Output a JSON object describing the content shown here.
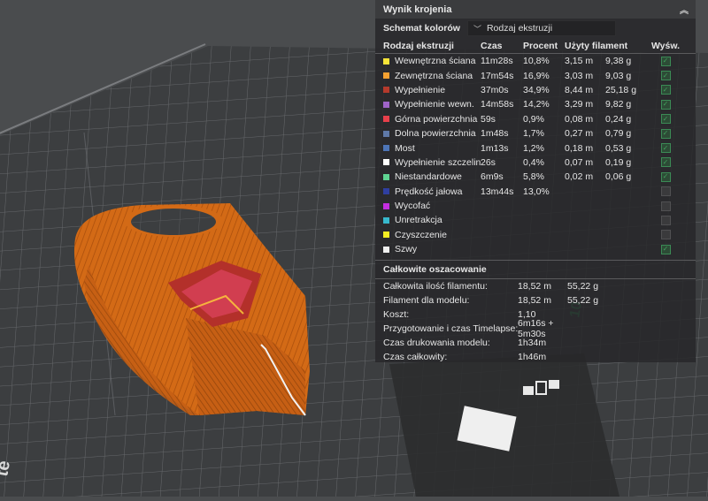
{
  "panel": {
    "title": "Wynik krojenia",
    "color_scheme_label": "Schemat kolorów",
    "color_scheme_value": "Rodzaj ekstruzji",
    "columns": [
      "Rodzaj ekstruzji",
      "Czas",
      "Procent",
      "Użyty filament",
      "Wyśw."
    ],
    "rows": [
      {
        "name": "Wewnętrzna ściana",
        "color": "#f7e438",
        "time": "11m28s",
        "percent": "10,8%",
        "m": "3,15 m",
        "g": "9,38 g",
        "shown": true
      },
      {
        "name": "Zewnętrzna ściana",
        "color": "#f5a131",
        "time": "17m54s",
        "percent": "16,9%",
        "m": "3,03 m",
        "g": "9,03 g",
        "shown": true
      },
      {
        "name": "Wypełnienie",
        "color": "#b53a2c",
        "time": "37m0s",
        "percent": "34,9%",
        "m": "8,44 m",
        "g": "25,18 g",
        "shown": true
      },
      {
        "name": "Wypełnienie wewn.",
        "color": "#9f64c8",
        "time": "14m58s",
        "percent": "14,2%",
        "m": "3,29 m",
        "g": "9,82 g",
        "shown": true
      },
      {
        "name": "Górna powierzchnia",
        "color": "#e8404b",
        "time": "59s",
        "percent": "0,9%",
        "m": "0,08 m",
        "g": "0,24 g",
        "shown": true
      },
      {
        "name": "Dolna powierzchnia",
        "color": "#5f79a8",
        "time": "1m48s",
        "percent": "1,7%",
        "m": "0,27 m",
        "g": "0,79 g",
        "shown": true
      },
      {
        "name": "Most",
        "color": "#4d75b7",
        "time": "1m13s",
        "percent": "1,2%",
        "m": "0,18 m",
        "g": "0,53 g",
        "shown": true
      },
      {
        "name": "Wypełnienie szczelin",
        "color": "#ffffff",
        "time": "26s",
        "percent": "0,4%",
        "m": "0,07 m",
        "g": "0,19 g",
        "shown": true
      },
      {
        "name": "Niestandardowe",
        "color": "#5fd492",
        "time": "6m9s",
        "percent": "5,8%",
        "m": "0,02 m",
        "g": "0,06 g",
        "shown": true
      },
      {
        "name": "Prędkość jałowa",
        "color": "#2f3fa0",
        "time": "13m44s",
        "percent": "13,0%",
        "m": "",
        "g": "",
        "shown": false
      },
      {
        "name": "Wycofać",
        "color": "#c42ee0",
        "time": "",
        "percent": "",
        "m": "",
        "g": "",
        "shown": false
      },
      {
        "name": "Unretrakcja",
        "color": "#37b8cc",
        "time": "",
        "percent": "",
        "m": "",
        "g": "",
        "shown": false
      },
      {
        "name": "Czyszczenie",
        "color": "#f4ed23",
        "time": "",
        "percent": "",
        "m": "",
        "g": "",
        "shown": false
      },
      {
        "name": "Szwy",
        "color": "#efefef",
        "time": "",
        "percent": "",
        "m": "",
        "g": "",
        "shown": true
      }
    ],
    "summary_title": "Całkowite oszacowanie",
    "summary": [
      {
        "label": "Całkowita ilość filamentu:",
        "v1": "18,52 m",
        "v2": "55,22 g"
      },
      {
        "label": "Filament dla modelu:",
        "v1": "18,52 m",
        "v2": "55,22 g"
      },
      {
        "label": "Koszt:",
        "v1": "1,10",
        "v2": ""
      },
      {
        "label": "Przygotowanie i czas Timelapse:",
        "v1": "6m16s + 5m30s",
        "v2": ""
      },
      {
        "label": "Czas drukowania modelu:",
        "v1": "1h34m",
        "v2": ""
      },
      {
        "label": "Czas całkowity:",
        "v1": "1h46m",
        "v2": ""
      }
    ]
  },
  "viewport": {
    "model_color": "#d36a16",
    "plate_color": "#3c3e40"
  }
}
